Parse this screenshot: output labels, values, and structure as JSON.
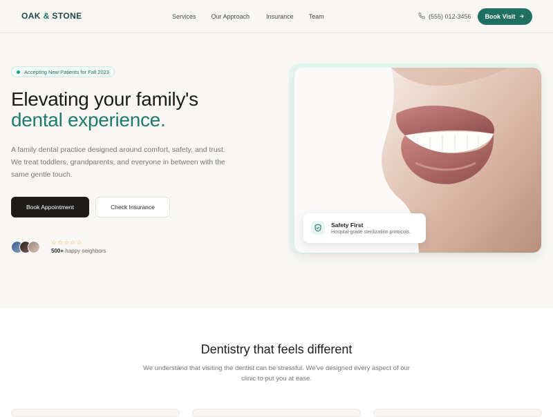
{
  "brand": {
    "name_left": "OAK",
    "amp": "&",
    "name_right": "STONE"
  },
  "nav": {
    "links": [
      "Services",
      "Our Approach",
      "Insurance",
      "Team"
    ],
    "phone": "(555) 012-3456",
    "cta": "Book Visit"
  },
  "hero": {
    "badge": "Accepting New Patients for Fall 2023",
    "headline_line1": "Elevating your family's",
    "headline_line2": "dental experience.",
    "lead": "A family dental practice designed around comfort, safety, and trust. We treat toddlers, grandparents, and everyone in between with the same gentle touch.",
    "primary_button": "Book Appointment",
    "secondary_button": "Check Insurance",
    "rating_stars": 5,
    "social_count": "500+",
    "social_text": "happy neighbors",
    "safety_title": "Safety First",
    "safety_sub": "Hospital-grade sterilization protocols."
  },
  "section2": {
    "title": "Dentistry that feels different",
    "subtitle": "We understand that visiting the dentist can be stressful. We've designed every aspect of our clinic to put you at ease."
  },
  "colors": {
    "accent": "#1f6f62",
    "dark": "#1e1c1a",
    "star": "#f0b42a",
    "hero_bg": "#f8f7f4"
  }
}
